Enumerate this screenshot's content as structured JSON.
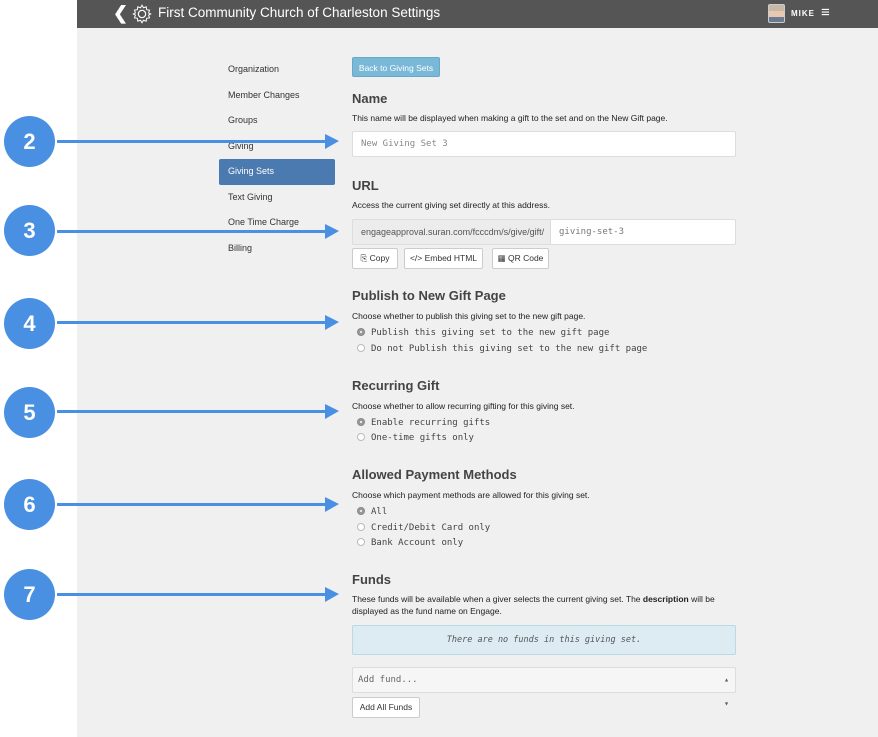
{
  "topbar": {
    "back_icon": "chevron-left-icon",
    "gear_icon": "gear-icon",
    "title": "First Community Church of Charleston  Settings",
    "user": "MIKE",
    "menu_glyph": "≡"
  },
  "sidebar": {
    "items": [
      {
        "label": "Organization"
      },
      {
        "label": "Member Changes"
      },
      {
        "label": "Groups"
      },
      {
        "label": "Giving"
      },
      {
        "label": "Giving Sets",
        "active": true
      },
      {
        "label": "Text Giving"
      },
      {
        "label": "One Time Charge"
      },
      {
        "label": "Billing"
      }
    ]
  },
  "main": {
    "back_button": "Back to Giving Sets",
    "name": {
      "heading": "Name",
      "description": "This name will be displayed when making a gift to the set and on the New Gift page.",
      "value": "New Giving Set 3"
    },
    "url": {
      "heading": "URL",
      "description": "Access the current giving set directly at this address.",
      "prefix": "engageapproval.suran.com/fcccdm/s/give/gift/",
      "slug": "giving-set-3",
      "copy_label": "⎘ Copy",
      "embed_label": "</> Embed HTML",
      "qr_label": "▦ QR Code"
    },
    "publish": {
      "heading": "Publish to New Gift Page",
      "description": "Choose whether to publish this giving set to the new gift page.",
      "options": [
        "Publish this giving set to the new gift page",
        "Do not Publish this giving set to the new gift page"
      ],
      "selected": 0
    },
    "recurring": {
      "heading": "Recurring Gift",
      "description": "Choose whether to allow recurring gifting for this giving set.",
      "options": [
        "Enable recurring gifts",
        "One-time gifts only"
      ],
      "selected": 0
    },
    "payment": {
      "heading": "Allowed Payment Methods",
      "description": "Choose which payment methods are allowed for this giving set.",
      "options": [
        "All",
        "Credit/Debit Card only",
        "Bank Account only"
      ],
      "selected": 0
    },
    "funds": {
      "heading": "Funds",
      "description_pre": "These funds will be available when a giver selects the current giving set. The ",
      "description_bold": "description",
      "description_post": " will be displayed as the fund name on Engage.",
      "empty_message": "There are no funds in this giving set.",
      "add_placeholder": "Add fund...",
      "add_all_label": "Add All Funds"
    }
  },
  "callouts": [
    "2",
    "3",
    "4",
    "5",
    "6",
    "7"
  ],
  "colors": {
    "callout": "#4a90e2",
    "topbar": "#555555",
    "active_nav": "#4a7ab0",
    "primary_button": "#7ab8d8"
  }
}
